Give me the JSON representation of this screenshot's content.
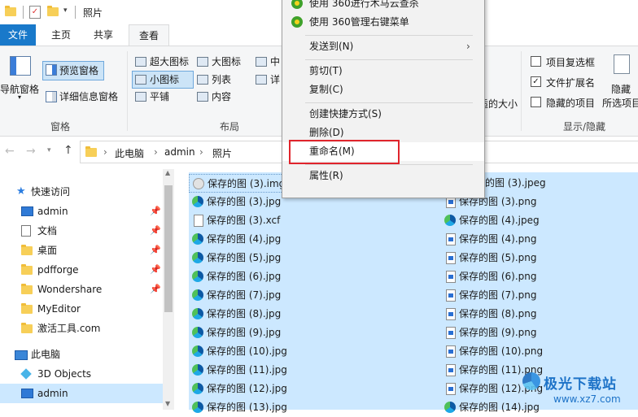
{
  "window": {
    "title": "照片"
  },
  "ribbon_tabs": [
    "文件",
    "主页",
    "共享",
    "查看"
  ],
  "ribbon": {
    "panes": {
      "nav_pane": "导航窗格",
      "preview_pane": "预览窗格",
      "details_pane": "详细信息窗格",
      "group": "窗格"
    },
    "layout": {
      "items": [
        "超大图标",
        "大图标",
        "中",
        "小图标",
        "列表",
        "详",
        "平铺",
        "内容"
      ],
      "group": "布局"
    },
    "size_all": "适的大小",
    "show_hide": {
      "item_checkboxes": "项目复选框",
      "file_ext": "文件扩展名",
      "hidden_items": "隐藏的项目",
      "hide_selected_1": "隐藏",
      "hide_selected_2": "所选项目",
      "group": "显示/隐藏"
    }
  },
  "breadcrumb": [
    "此电脑",
    "admin",
    "照片"
  ],
  "nav_pane": {
    "items": [
      {
        "label": "快速访问",
        "icon": "star-icon",
        "pinned": false
      },
      {
        "label": "admin",
        "icon": "monitor-icon",
        "pinned": true
      },
      {
        "label": "文档",
        "icon": "document-icon",
        "pinned": true
      },
      {
        "label": "桌面",
        "icon": "folder-icon",
        "pinned": true
      },
      {
        "label": "pdfforge",
        "icon": "folder-icon",
        "pinned": true
      },
      {
        "label": "Wondershare",
        "icon": "folder-icon",
        "pinned": true
      },
      {
        "label": "MyEditor",
        "icon": "folder-icon",
        "pinned": false
      },
      {
        "label": "激活工具.com",
        "icon": "folder-icon",
        "pinned": false
      },
      {
        "label": "此电脑",
        "icon": "computer-icon",
        "pinned": false
      },
      {
        "label": "3D Objects",
        "icon": "cube-icon",
        "pinned": false
      },
      {
        "label": "admin",
        "icon": "monitor-icon",
        "pinned": false
      }
    ]
  },
  "files_left": [
    {
      "name": "保存的图 (3).img",
      "icon": "disc-image-icon"
    },
    {
      "name": "保存的图 (3).jpg",
      "icon": "edge-icon"
    },
    {
      "name": "保存的图 (3).xcf",
      "icon": "file-icon"
    },
    {
      "name": "保存的图 (4).jpg",
      "icon": "edge-icon"
    },
    {
      "name": "保存的图 (5).jpg",
      "icon": "edge-icon"
    },
    {
      "name": "保存的图 (6).jpg",
      "icon": "edge-icon"
    },
    {
      "name": "保存的图 (7).jpg",
      "icon": "edge-icon"
    },
    {
      "name": "保存的图 (8).jpg",
      "icon": "edge-icon"
    },
    {
      "name": "保存的图 (9).jpg",
      "icon": "edge-icon"
    },
    {
      "name": "保存的图 (10).jpg",
      "icon": "edge-icon"
    },
    {
      "name": "保存的图 (11).jpg",
      "icon": "edge-icon"
    },
    {
      "name": "保存的图 (12).jpg",
      "icon": "edge-icon"
    },
    {
      "name": "保存的图 (13).jpg",
      "icon": "edge-icon"
    }
  ],
  "files_right": [
    {
      "name": "的图 (3).jpeg",
      "icon": "edge-icon"
    },
    {
      "name": "保存的图 (3).png",
      "icon": "png-icon"
    },
    {
      "name": "保存的图 (4).jpeg",
      "icon": "edge-icon"
    },
    {
      "name": "保存的图 (4).png",
      "icon": "png-icon"
    },
    {
      "name": "保存的图 (5).png",
      "icon": "png-icon"
    },
    {
      "name": "保存的图 (6).png",
      "icon": "png-icon"
    },
    {
      "name": "保存的图 (7).png",
      "icon": "png-icon"
    },
    {
      "name": "保存的图 (8).png",
      "icon": "png-icon"
    },
    {
      "name": "保存的图 (9).png",
      "icon": "png-icon"
    },
    {
      "name": "保存的图 (10).png",
      "icon": "png-icon"
    },
    {
      "name": "保存的图 (11).png",
      "icon": "png-icon"
    },
    {
      "name": "保存的图 (12).png",
      "icon": "png-icon"
    },
    {
      "name": "保存的图 (14).jpg",
      "icon": "edge-icon"
    }
  ],
  "context_menu": {
    "item_360_trojan": "使用 360进行木马云查杀",
    "item_360_manage": "使用 360管理右键菜单",
    "send_to": "发送到(N)",
    "cut": "剪切(T)",
    "copy": "复制(C)",
    "create_shortcut": "创建快捷方式(S)",
    "delete": "删除(D)",
    "rename": "重命名(M)",
    "properties": "属性(R)"
  },
  "watermark": {
    "brand": "极光下载站",
    "url": "www.xz7.com"
  },
  "colors": {
    "accent": "#1979ca",
    "selection": "#cce8ff",
    "highlight_box": "#e0242c"
  }
}
